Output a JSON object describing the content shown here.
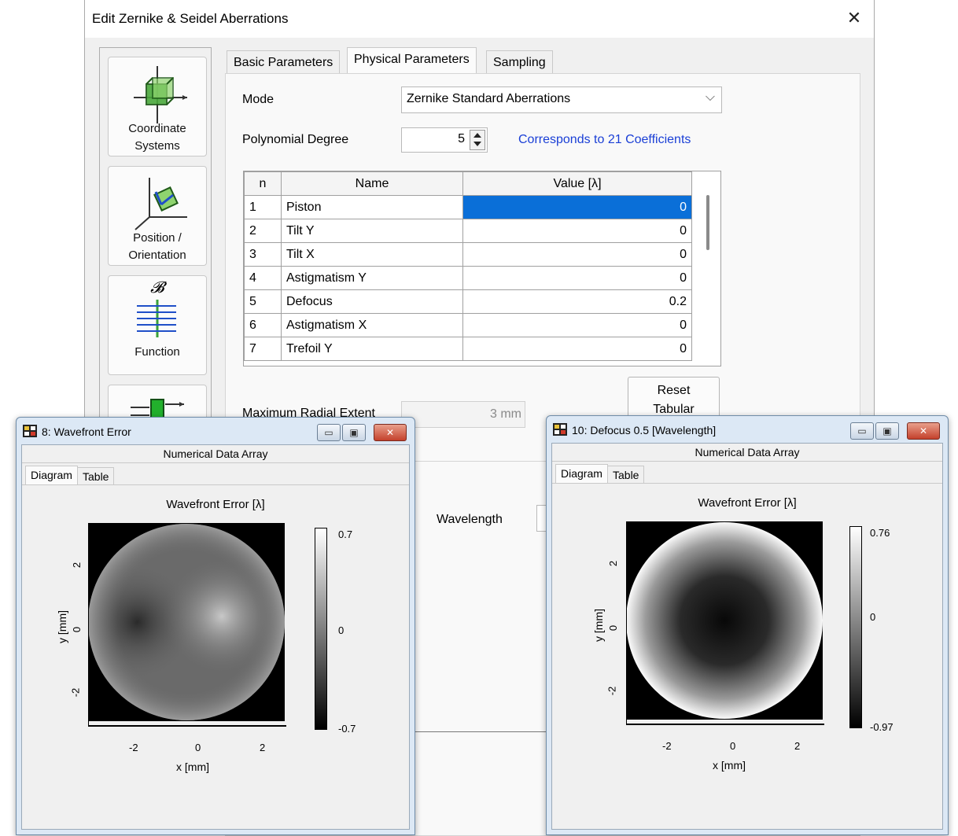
{
  "dialog": {
    "title": "Edit Zernike & Seidel Aberrations",
    "close_glyph": "✕",
    "side_buttons": [
      "Coordinate Systems",
      "Position / Orientation",
      "Function"
    ],
    "side_buttons_lines": [
      [
        "Coordinate",
        "Systems"
      ],
      [
        "Position /",
        "Orientation"
      ],
      [
        "Function"
      ]
    ],
    "function_glyph": "𝓑",
    "tabs": [
      "Basic Parameters",
      "Physical Parameters",
      "Sampling"
    ],
    "active_tab": "Physical Parameters",
    "mode_label": "Mode",
    "mode_value": "Zernike Standard Aberrations",
    "degree_label": "Polynomial Degree",
    "degree_value": "5",
    "coeff_note": "Corresponds to 21 Coefficients",
    "table": {
      "headers": [
        "n",
        "Name",
        "Value [λ]"
      ],
      "rows": [
        {
          "n": "1",
          "name": "Piston",
          "value": "0"
        },
        {
          "n": "2",
          "name": "Tilt Y",
          "value": "0"
        },
        {
          "n": "3",
          "name": "Tilt X",
          "value": "0"
        },
        {
          "n": "4",
          "name": "Astigmatism Y",
          "value": "0"
        },
        {
          "n": "5",
          "name": "Defocus",
          "value": "0.2"
        },
        {
          "n": "6",
          "name": "Astigmatism X",
          "value": "0"
        },
        {
          "n": "7",
          "name": "Trefoil Y",
          "value": "0"
        }
      ],
      "selected_row": 0
    },
    "reset_lines": [
      "Reset",
      "Tabular"
    ],
    "max_radial_label": "Maximum Radial Extent",
    "max_radial_value": "3 mm",
    "wavelength_label": "Wavelength"
  },
  "win_wavefront": {
    "title": "8: Wavefront Error",
    "header": "Numerical Data Array",
    "tabs": [
      "Diagram",
      "Table"
    ],
    "active_tab": "Diagram",
    "chart_title": "Wavefront Error [λ]",
    "xlabel": "x [mm]",
    "ylabel": "y [mm]",
    "x_ticks": [
      "-2",
      "0",
      "2"
    ],
    "y_ticks": [
      "2",
      "0",
      "-2"
    ],
    "cbar_ticks": [
      "0.7",
      "0",
      "-0.7"
    ]
  },
  "win_defocus": {
    "title": "10: Defocus 0.5 [Wavelength]",
    "header": "Numerical Data Array",
    "tabs": [
      "Diagram",
      "Table"
    ],
    "active_tab": "Diagram",
    "chart_title": "Wavefront Error [λ]",
    "xlabel": "x [mm]",
    "ylabel": "y [mm]",
    "x_ticks": [
      "-2",
      "0",
      "2"
    ],
    "y_ticks": [
      "2",
      "0",
      "-2"
    ],
    "cbar_ticks": [
      "0.76",
      "0",
      "-0.97"
    ]
  },
  "window_controls": [
    "minimize-glyph",
    "maximize-glyph",
    "close-glyph"
  ],
  "chart_data": [
    {
      "type": "heatmap",
      "title": "Wavefront Error [λ]",
      "xlabel": "x [mm]",
      "ylabel": "y [mm]",
      "xlim": [
        -3,
        3
      ],
      "ylim": [
        -3,
        3
      ],
      "x_ticks": [
        -2,
        0,
        2
      ],
      "y_ticks": [
        -2,
        0,
        2
      ],
      "colorbar": {
        "min": -0.7,
        "max": 0.7,
        "ticks": [
          0.7,
          0,
          -0.7
        ],
        "colormap": "gray"
      },
      "aperture_radius": 3
    },
    {
      "type": "heatmap",
      "title": "Wavefront Error [λ]",
      "xlabel": "x [mm]",
      "ylabel": "y [mm]",
      "xlim": [
        -3,
        3
      ],
      "ylim": [
        -3,
        3
      ],
      "x_ticks": [
        -2,
        0,
        2
      ],
      "y_ticks": [
        -2,
        0,
        2
      ],
      "colorbar": {
        "min": -0.97,
        "max": 0.76,
        "ticks": [
          0.76,
          0,
          -0.97
        ],
        "colormap": "gray"
      },
      "aperture_radius": 3
    }
  ]
}
